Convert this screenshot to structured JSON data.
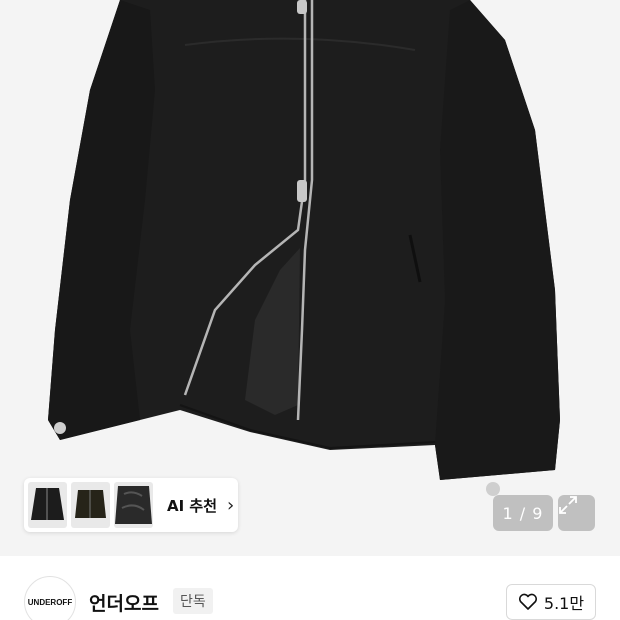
{
  "product": {
    "image_alt": "black suede zip-up jacket",
    "ai_recommendation": {
      "label": "AI 추천",
      "thumbnails": [
        "jacket-thumb-1",
        "jacket-thumb-2",
        "jacket-thumb-3"
      ]
    },
    "gallery": {
      "counter": "1 / 9"
    }
  },
  "brand": {
    "logo_text": "UNDEROFF",
    "name": "언더오프",
    "badge": "단독",
    "likes": "5.1만"
  },
  "icons": {
    "chevron": "chevron-right-icon",
    "expand": "expand-icon",
    "heart": "heart-icon"
  },
  "colors": {
    "jacket": "#1c1c1c",
    "background": "#f4f4f4"
  }
}
